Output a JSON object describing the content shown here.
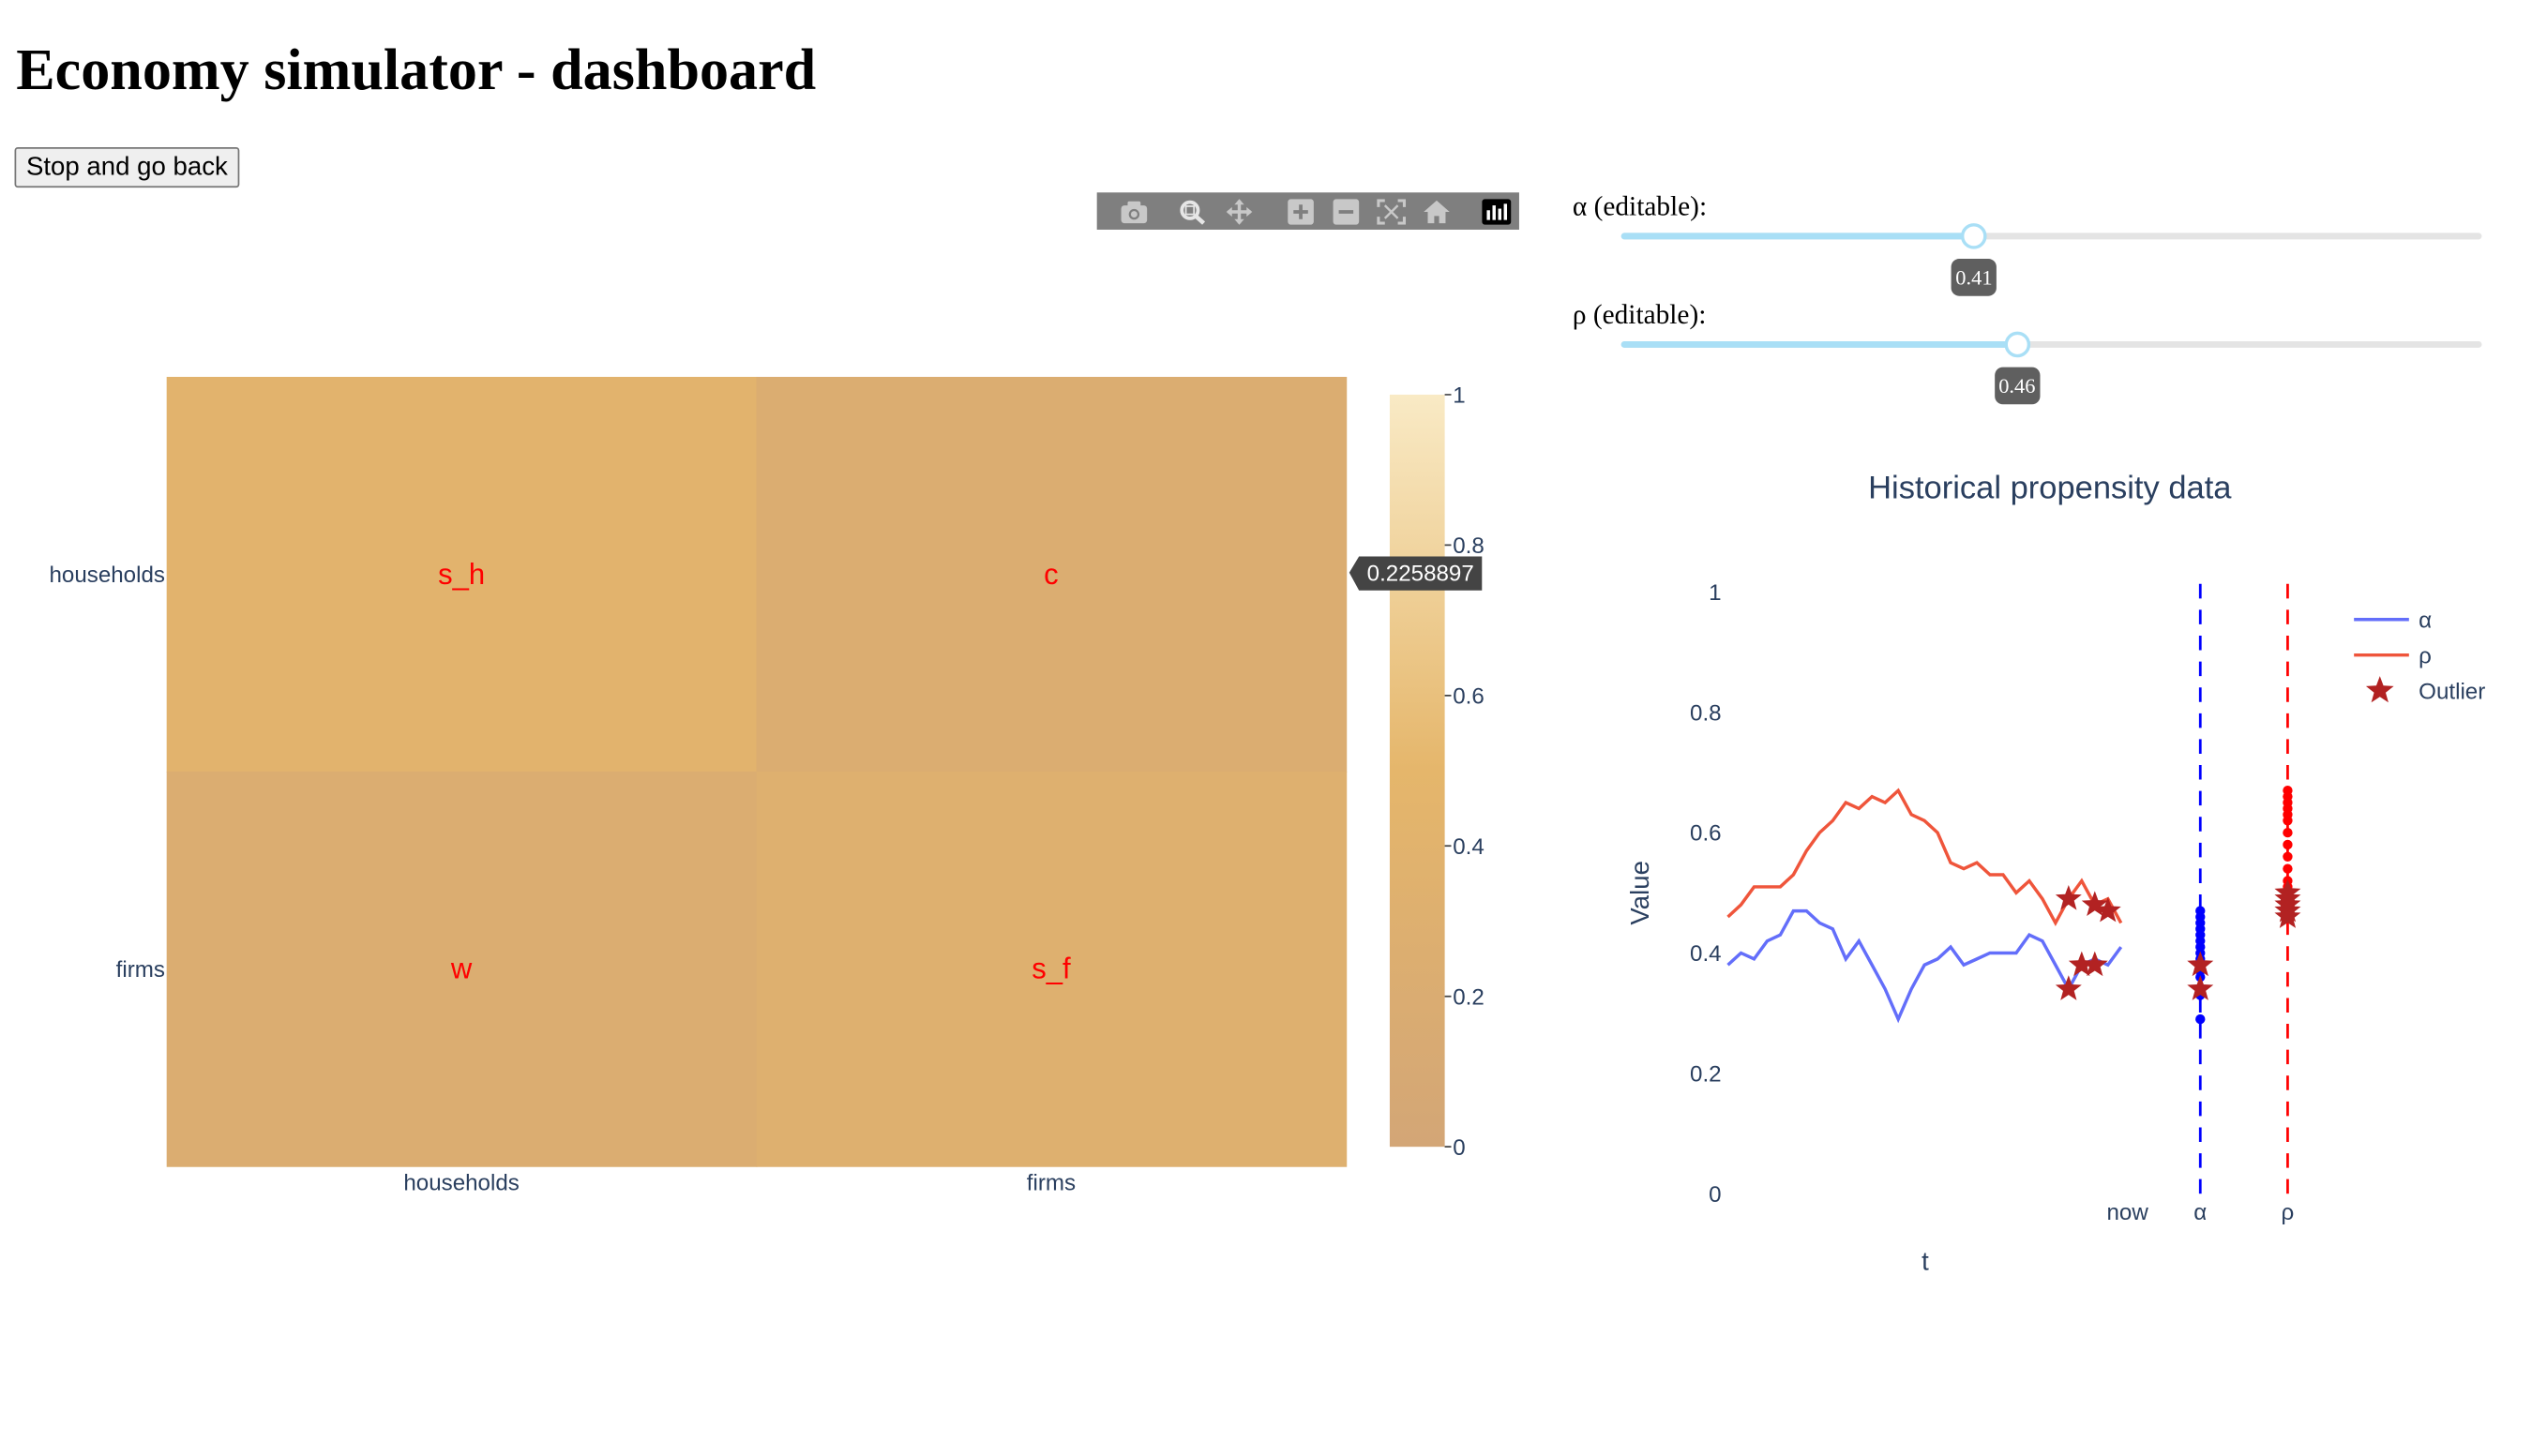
{
  "page": {
    "title": "Economy simulator - dashboard",
    "back_button": "Stop and go back"
  },
  "modebar": {
    "buttons": [
      "camera-icon",
      "zoom-icon",
      "pan-icon",
      "zoom-in-icon",
      "zoom-out-icon",
      "autoscale-icon",
      "reset-axes-icon",
      "plotly-logo-icon"
    ]
  },
  "sliders": [
    {
      "label": "α (editable):",
      "value": 0.41,
      "value_text": "0.41",
      "min": 0,
      "max": 1
    },
    {
      "label": "ρ (editable):",
      "value": 0.46,
      "value_text": "0.46",
      "min": 0,
      "max": 1
    }
  ],
  "heatmap": {
    "x_categories": [
      "households",
      "firms"
    ],
    "y_categories": [
      "households",
      "firms"
    ],
    "cells": [
      {
        "row": 0,
        "col": 0,
        "text": "s_h",
        "value": 0.41
      },
      {
        "row": 0,
        "col": 1,
        "text": "c",
        "value": 0.2258897
      },
      {
        "row": 1,
        "col": 0,
        "text": "w",
        "value": 0.22
      },
      {
        "row": 1,
        "col": 1,
        "text": "s_f",
        "value": 0.3
      }
    ],
    "text_color": "#ff0000",
    "colorscale": [
      "#d3a676",
      "#e5b66b",
      "#f9eac5"
    ],
    "colorbar_ticks": [
      "0",
      "0.2",
      "0.4",
      "0.6",
      "0.8",
      "1"
    ],
    "hover_label": "0.2258897"
  },
  "chart_data": {
    "type": "line",
    "title": "Historical propensity data",
    "xlabel": "t",
    "ylabel": "Value",
    "ylim": [
      0,
      1
    ],
    "y_ticks": [
      "0",
      "0.2",
      "0.4",
      "0.6",
      "0.8",
      "1"
    ],
    "x_ticks": [
      "now",
      "α",
      "ρ"
    ],
    "grid": false,
    "legend_position": "top-right",
    "series": [
      {
        "name": "α",
        "color": "#636efa",
        "values": [
          0.38,
          0.4,
          0.39,
          0.42,
          0.43,
          0.47,
          0.47,
          0.45,
          0.44,
          0.39,
          0.42,
          0.38,
          0.34,
          0.29,
          0.34,
          0.38,
          0.39,
          0.41,
          0.38,
          0.39,
          0.4,
          0.4,
          0.4,
          0.43,
          0.42,
          0.38,
          0.34,
          0.38,
          0.39,
          0.38,
          0.41
        ]
      },
      {
        "name": "ρ",
        "color": "#ef553b",
        "values": [
          0.46,
          0.48,
          0.51,
          0.51,
          0.51,
          0.53,
          0.57,
          0.6,
          0.62,
          0.65,
          0.64,
          0.66,
          0.65,
          0.67,
          0.63,
          0.62,
          0.6,
          0.55,
          0.54,
          0.55,
          0.53,
          0.53,
          0.5,
          0.52,
          0.49,
          0.45,
          0.49,
          0.52,
          0.48,
          0.49,
          0.45
        ]
      }
    ],
    "outliers": {
      "name": "Outlier",
      "color": "#b22222",
      "points": [
        [
          26,
          0.34
        ],
        [
          27,
          0.38
        ],
        [
          28,
          0.38
        ],
        [
          26,
          0.49
        ],
        [
          28,
          0.48
        ],
        [
          29,
          0.47
        ]
      ]
    },
    "distributions": [
      {
        "name": "α",
        "color": "#0000ff",
        "values": [
          0.29,
          0.33,
          0.34,
          0.36,
          0.37,
          0.38,
          0.39,
          0.4,
          0.41,
          0.42,
          0.43,
          0.44,
          0.45,
          0.46,
          0.47
        ],
        "outliers": [
          0.34,
          0.38
        ]
      },
      {
        "name": "ρ",
        "color": "#ff0000",
        "values": [
          0.46,
          0.47,
          0.48,
          0.49,
          0.5,
          0.51,
          0.52,
          0.54,
          0.56,
          0.58,
          0.6,
          0.62,
          0.63,
          0.64,
          0.65,
          0.66,
          0.67
        ],
        "outliers": [
          0.46,
          0.47,
          0.48,
          0.49,
          0.5
        ]
      }
    ]
  }
}
